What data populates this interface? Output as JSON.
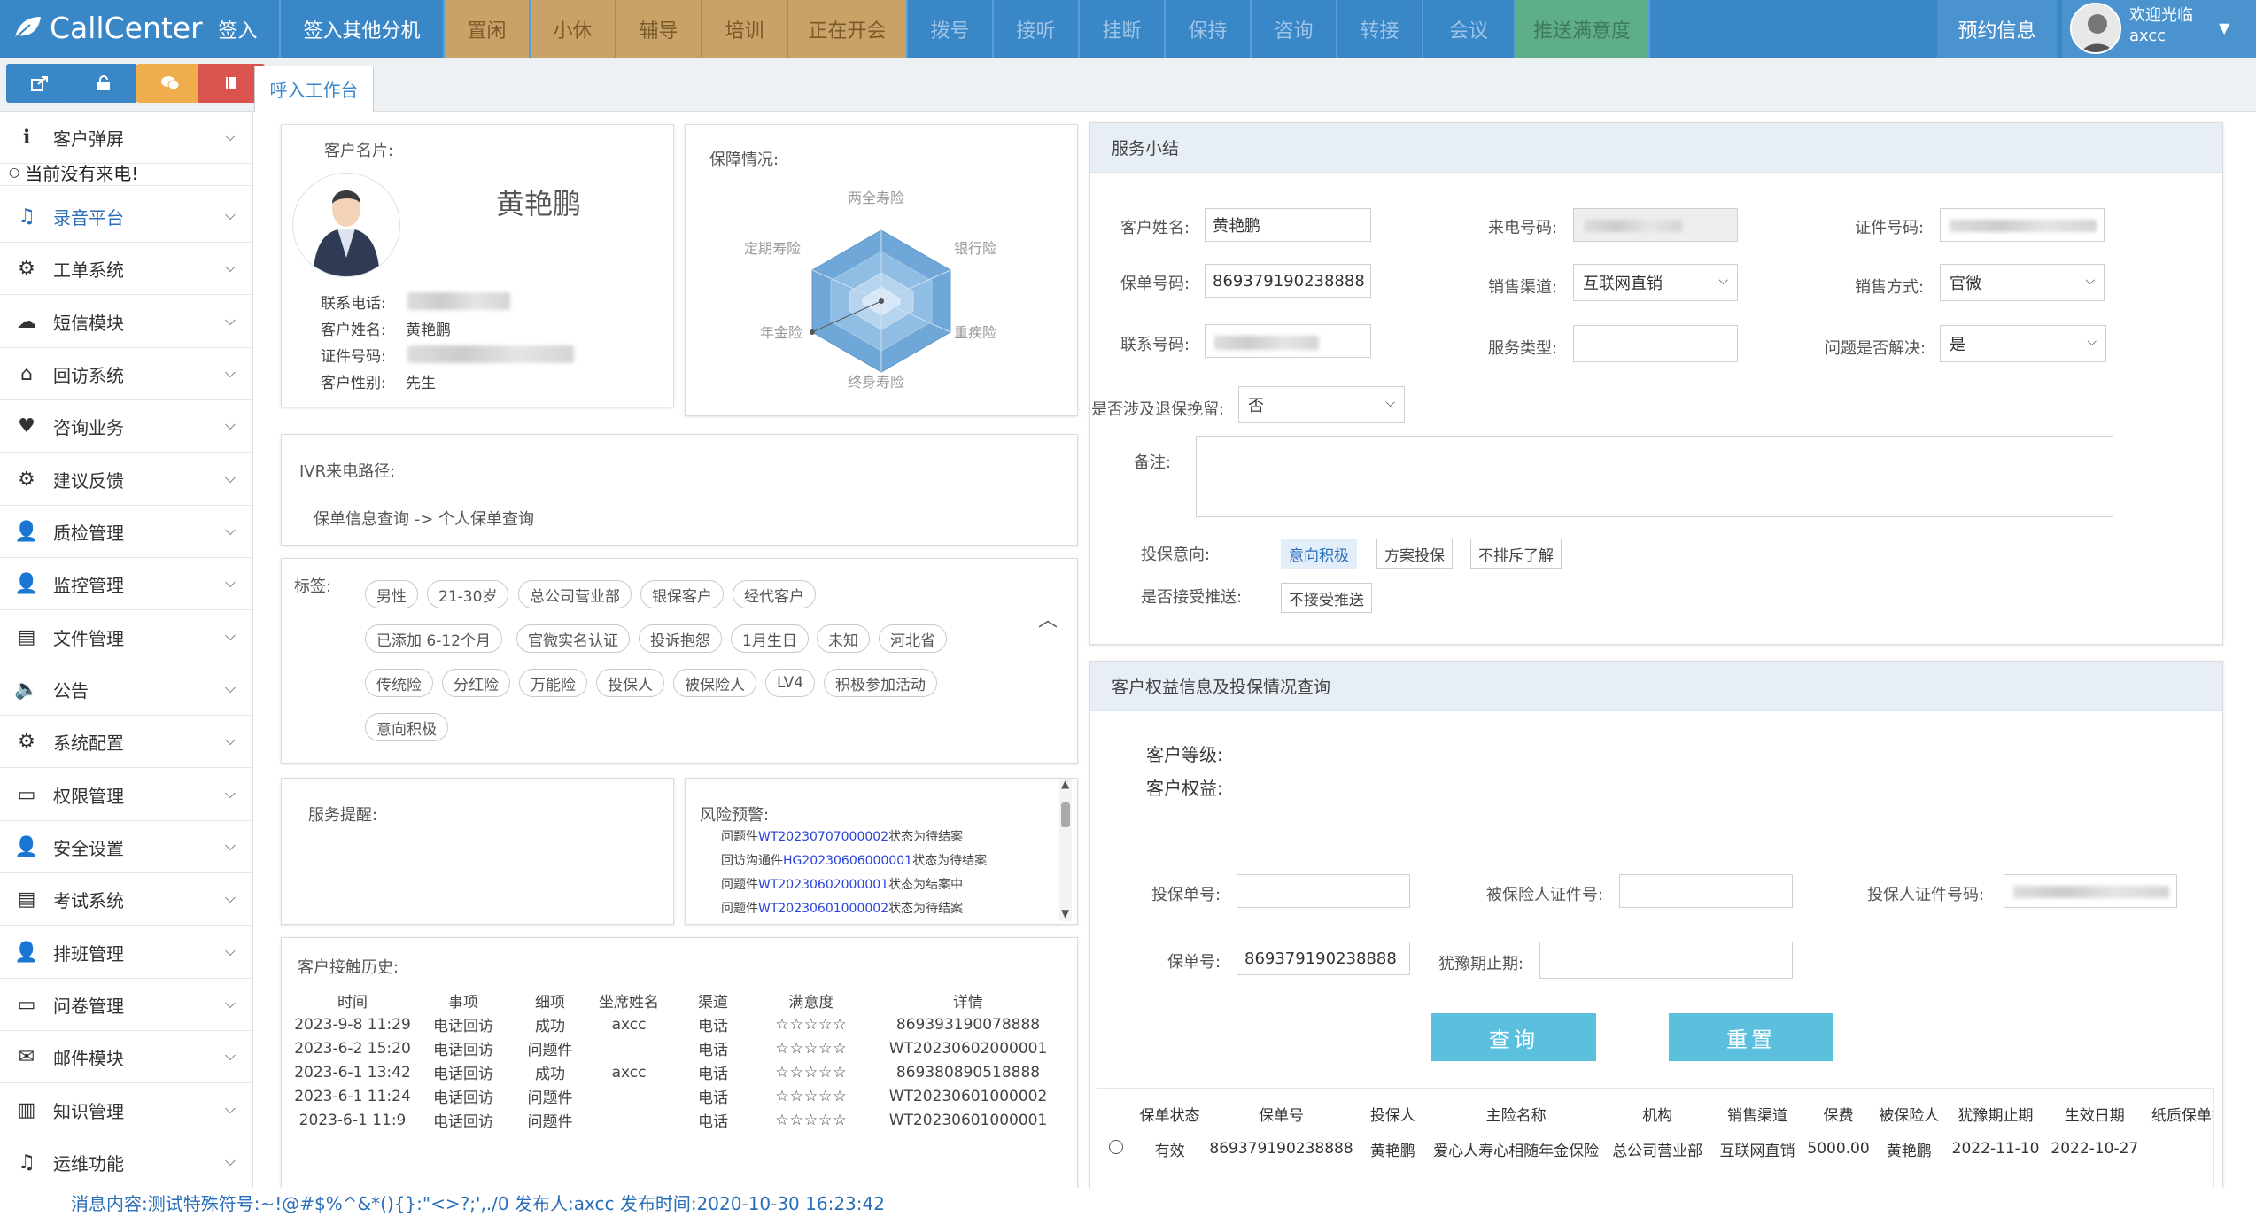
{
  "app": {
    "logo": "CallCenter"
  },
  "topbar": {
    "buttons": [
      {
        "label": "签入"
      },
      {
        "label": "签入其他分机"
      },
      {
        "label": "置闲"
      },
      {
        "label": "小休"
      },
      {
        "label": "辅导"
      },
      {
        "label": "培训"
      },
      {
        "label": "正在开会"
      },
      {
        "label": "拨号"
      },
      {
        "label": "接听"
      },
      {
        "label": "挂断"
      },
      {
        "label": "保持"
      },
      {
        "label": "咨询"
      },
      {
        "label": "转接"
      },
      {
        "label": "会议"
      },
      {
        "label": "推送满意度"
      }
    ],
    "appointment": "预约信息",
    "welcome": "欢迎光临",
    "username": "axcc",
    "accent": "#3a87c8"
  },
  "toolbar": {
    "icons": [
      "share-icon",
      "unlock-icon",
      "chat-icon",
      "book-icon"
    ],
    "tab": "呼入工作台"
  },
  "sidebar": {
    "items": [
      {
        "label": "客户弹屏",
        "icon": "info-icon"
      },
      {
        "label": "录音平台",
        "icon": "music-icon"
      },
      {
        "label": "工单系统",
        "icon": "cogs-icon"
      },
      {
        "label": "短信模块",
        "icon": "comments-icon"
      },
      {
        "label": "回访系统",
        "icon": "home-icon"
      },
      {
        "label": "咨询业务",
        "icon": "heart-icon"
      },
      {
        "label": "建议反馈",
        "icon": "cogs-icon"
      },
      {
        "label": "质检管理",
        "icon": "user-icon"
      },
      {
        "label": "监控管理",
        "icon": "user-icon"
      },
      {
        "label": "文件管理",
        "icon": "file-icon"
      },
      {
        "label": "公告",
        "icon": "volume-icon"
      },
      {
        "label": "系统配置",
        "icon": "cogs-icon"
      },
      {
        "label": "权限管理",
        "icon": "card-icon"
      },
      {
        "label": "安全设置",
        "icon": "user-icon"
      },
      {
        "label": "考试系统",
        "icon": "file-icon"
      },
      {
        "label": "排班管理",
        "icon": "user-icon"
      },
      {
        "label": "问卷管理",
        "icon": "card-icon"
      },
      {
        "label": "邮件模块",
        "icon": "mail-icon"
      },
      {
        "label": "知识管理",
        "icon": "book-icon"
      },
      {
        "label": "运维功能",
        "icon": "music-icon"
      }
    ],
    "no_call": "当前没有来电!"
  },
  "customer_card": {
    "title": "客户名片:",
    "name": "黄艳鹏",
    "phone_label": "联系电话:",
    "name_label": "客户姓名:",
    "name_value": "黄艳鹏",
    "id_label": "证件号码:",
    "gender_label": "客户性别:",
    "gender_value": "先生"
  },
  "coverage": {
    "title": "保障情况:",
    "axes": [
      "两全寿险",
      "银行险",
      "重疾险",
      "终身寿险",
      "年金险",
      "定期寿险"
    ]
  },
  "ivr": {
    "title": "IVR来电路径:",
    "path": "保单信息查询 -> 个人保单查询"
  },
  "tags": {
    "title": "标签:",
    "rows": [
      [
        "男性",
        "21-30岁",
        "总公司营业部",
        "银保客户",
        "经代客户"
      ],
      [
        "已添加 6-12个月",
        "官微实名认证",
        "投诉抱怨",
        "1月生日",
        "未知",
        "河北省"
      ],
      [
        "传统险",
        "分红险",
        "万能险",
        "投保人",
        "被保险人",
        "LV4",
        "积极参加活动"
      ],
      [
        "意向积极"
      ]
    ]
  },
  "service_reminder": {
    "title": "服务提醒:"
  },
  "risk": {
    "title": "风险预警:",
    "lines": [
      {
        "pre": "问题件",
        "id": "WT20230707000002",
        "post": "状态为待结案"
      },
      {
        "pre": "回访沟通件",
        "id": "HG20230606000001",
        "post": "状态为待结案"
      },
      {
        "pre": "问题件",
        "id": "WT20230602000001",
        "post": "状态为结案中"
      },
      {
        "pre": "问题件",
        "id": "WT20230601000002",
        "post": "状态为待结案"
      }
    ]
  },
  "history": {
    "title": "客户接触历史:",
    "columns": [
      "时间",
      "事项",
      "细项",
      "坐席姓名",
      "渠道",
      "满意度",
      "详情"
    ],
    "rows": [
      {
        "time": "2023-9-8 11:29",
        "item": "电话回访",
        "sub": "成功",
        "agent": "axcc",
        "channel": "电话",
        "sat": "☆☆☆☆☆",
        "detail": "869393190078888"
      },
      {
        "time": "2023-6-2 15:20",
        "item": "电话回访",
        "sub": "问题件",
        "agent": "",
        "channel": "电话",
        "sat": "☆☆☆☆☆",
        "detail": "WT20230602000001"
      },
      {
        "time": "2023-6-1 13:42",
        "item": "电话回访",
        "sub": "成功",
        "agent": "axcc",
        "channel": "电话",
        "sat": "☆☆☆☆☆",
        "detail": "869380890518888"
      },
      {
        "time": "2023-6-1 11:24",
        "item": "电话回访",
        "sub": "问题件",
        "agent": "",
        "channel": "电话",
        "sat": "☆☆☆☆☆",
        "detail": "WT20230601000002"
      },
      {
        "time": "2023-6-1 11:9",
        "item": "电话回访",
        "sub": "问题件",
        "agent": "",
        "channel": "电话",
        "sat": "☆☆☆☆☆",
        "detail": "WT20230601000001"
      }
    ]
  },
  "summary": {
    "header": "服务小结",
    "cust_name_label": "客户姓名:",
    "cust_name": "黄艳鹏",
    "caller_label": "来电号码:",
    "id_label": "证件号码:",
    "policy_label": "保单号码:",
    "policy": "869379190238888",
    "channel_label": "销售渠道:",
    "channel": "互联网直销",
    "method_label": "销售方式:",
    "method": "官微",
    "contact_label": "联系号码:",
    "service_type_label": "服务类型:",
    "resolved_label": "问题是否解决:",
    "resolved": "是",
    "retention_label": "是否涉及退保挽留:",
    "retention": "否",
    "remark_label": "备注:",
    "intent_label": "投保意向:",
    "intent_options": [
      "意向积极",
      "方案投保",
      "不排斥了解"
    ],
    "push_label": "是否接受推送:",
    "push_options": [
      "不接受推送"
    ]
  },
  "rights": {
    "header": "客户权益信息及投保情况查询",
    "level_label": "客户等级:",
    "rights_label": "客户权益:",
    "policy_no_label": "投保单号:",
    "insured_id_label": "被保险人证件号:",
    "holder_id_label": "投保人证件号码:",
    "policy_label": "保单号:",
    "policy": "869379190238888",
    "hesitation_label": "犹豫期止期:",
    "query": "查询",
    "reset": "重置",
    "columns": [
      "保单状态",
      "保单号",
      "投保人",
      "主险名称",
      "机构",
      "销售渠道",
      "保费",
      "被保险人",
      "犹豫期止期",
      "生效日期",
      "纸质保单打印"
    ],
    "rows": [
      {
        "status": "有效",
        "policy": "869379190238888",
        "holder": "黄艳鹏",
        "product": "爱心人寿心相随年金保险",
        "org": "总公司营业部",
        "channel": "互联网直销",
        "premium": "5000.00",
        "insured": "黄艳鹏",
        "hesitation": "2022-11-10",
        "effective": "2022-10-27"
      }
    ]
  },
  "footer": {
    "message": "消息内容:测试特殊符号:~!@#$%^&*(){}:\"<>?;',./0   发布人:axcc   发布时间:2020-10-30 16:23:42"
  }
}
